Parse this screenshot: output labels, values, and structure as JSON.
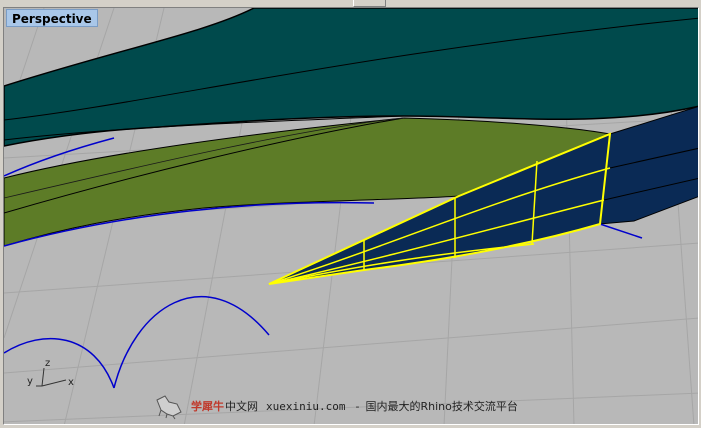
{
  "window": {
    "viewport_name": "Perspective"
  },
  "axes": {
    "x_label": "x",
    "y_label": "y",
    "z_label": "z"
  },
  "watermark": {
    "brand": "学犀牛",
    "cn": "中文网",
    "url": "xuexiniu.com",
    "separator": "-",
    "slogan": "国内最大的Rhino技术交流平台",
    "logo_icon": "rhino-logo-icon"
  },
  "colors": {
    "background": "#b8b8b8",
    "grid": "#a8a8a8",
    "teal_surface": "#004a4c",
    "navy_surface": "#0a2a55",
    "green_surface": "#5d7c27",
    "curve": "#0000cc",
    "selection": "#ffff00",
    "label_bg": "#a9c7e9"
  }
}
